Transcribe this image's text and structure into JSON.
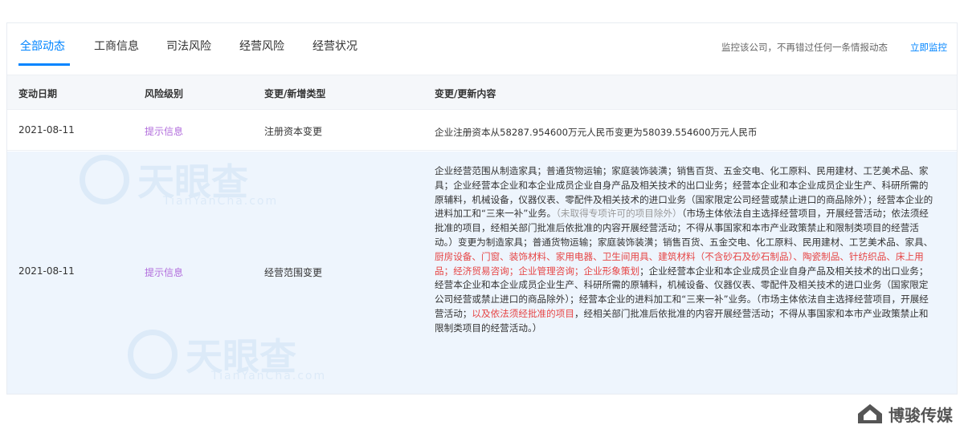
{
  "tabs": [
    "全部动态",
    "工商信息",
    "司法风险",
    "经营风险",
    "经营状况"
  ],
  "monitor": {
    "text": "监控该公司，不再错过任何一条情报动态",
    "link": "立即监控"
  },
  "columns": [
    "变动日期",
    "风险级别",
    "变更/新增类型",
    "变更/更新内容"
  ],
  "rows": [
    {
      "date": "2021-08-11",
      "risk": "提示信息",
      "type": "注册资本变更",
      "content": "企业注册资本从58287.954600万元人民币变更为58039.554600万元人民币"
    },
    {
      "date": "2021-08-11",
      "risk": "提示信息",
      "type": "经营范围变更",
      "content_parts": [
        "企业经营范围从制造家具；普通货物运输；家庭装饰装潢；销售百货、五金交电、化工原料、民用建材、工艺美术品、家具；企业经营本企业和本企业成员企业自身产品及相关技术的出口业务；经营本企业和本企业成员企业生产、科研所需的原辅料，机械设备，仪器仪表、零配件及相关技术的进口业务（国家限定公司经营或禁止进口的商品除外）；经营本企业的进料加工和“三来一补”业务。",
        "（未取得专项许可的项目除外）",
        "（市场主体依法自主选择经营项目，开展经营活动；依法须经批准的项目，经相关部门批准后依批准的内容开展经营活动；不得从事国家和本市产业政策禁止和限制类项目的经营活动。）变更为制造家具；普通货物运输；家庭装饰装潢；销售百货、五金交电、化工原料、民用建材、工艺美术品、家具、",
        "厨房设备、门窗、装饰材料、家用电器、卫生间用具、建筑材料（不含砂石及砂石制品）、陶瓷制品、针纺织品、床上用品；经济贸易咨询；企业管理咨询；企业形象策划",
        "；企业经营本企业和本企业成员企业自身产品及相关技术的出口业务；经营本企业和本企业成员企业生产、科研所需的原辅料，机械设备、仪器仪表、零配件及相关技术的进口业务（国家限定公司经营或禁止进口的商品除外）；经营本企业的进料加工和“三来一补”业务。（市场主体依法自主选择经营项目，开展经营活动；",
        "以及依法须经批准的项目",
        "，经相关部门批准后依批准的内容开展经营活动；不得从事国家和本市产业政策禁止和限制类项目的经营活动。）"
      ]
    }
  ],
  "watermark": {
    "text": "天眼查",
    "sub": "TianYanCha.com"
  },
  "brand": {
    "text": "博骏传媒"
  },
  "colors": {
    "accent": "#0084ff",
    "risk": "#b16cdc",
    "highlight_red": "#e64545",
    "note_gray": "#999999",
    "row_highlight": "#eef5fd"
  }
}
